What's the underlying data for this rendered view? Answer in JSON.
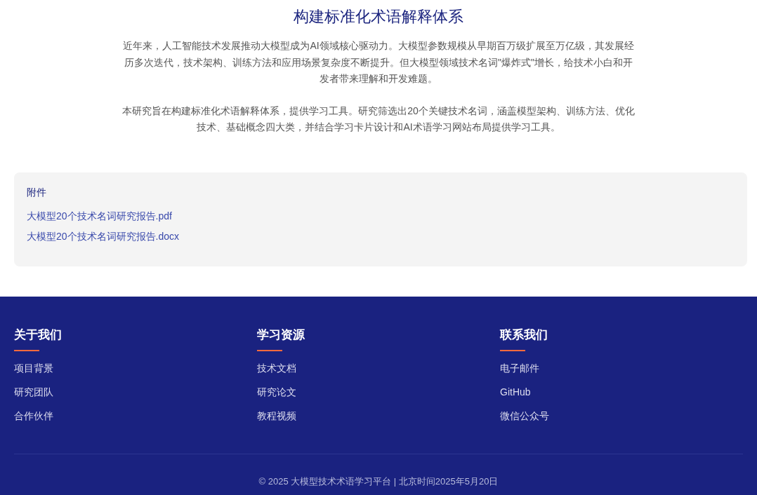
{
  "intro": {
    "title": "构建标准化术语解释体系",
    "paragraphs": [
      "近年来，人工智能技术发展推动大模型成为AI领域核心驱动力。大模型参数规模从早期百万级扩展至万亿级，其发展经历多次迭代，技术架构、训练方法和应用场景复杂度不断提升。但大模型领域技术名词\"爆炸式\"增长，给技术小白和开发者带来理解和开发难题。",
      "本研究旨在构建标准化术语解释体系，提供学习工具。研究筛选出20个关键技术名词，涵盖模型架构、训练方法、优化技术、基础概念四大类，并结合学习卡片设计和AI术语学习网站布局提供学习工具。"
    ]
  },
  "attachments": {
    "title": "附件",
    "files": [
      "大模型20个技术名词研究报告.pdf",
      "大模型20个技术名词研究报告.docx"
    ]
  },
  "footer": {
    "columns": [
      {
        "heading": "关于我们",
        "links": [
          "项目背景",
          "研究团队",
          "合作伙伴"
        ]
      },
      {
        "heading": "学习资源",
        "links": [
          "技术文档",
          "研究论文",
          "教程视频"
        ]
      },
      {
        "heading": "联系我们",
        "links": [
          "电子邮件",
          "GitHub",
          "微信公众号"
        ]
      }
    ],
    "copyright": "© 2025 大模型技术术语学习平台 | 北京时间2025年5月20日"
  }
}
